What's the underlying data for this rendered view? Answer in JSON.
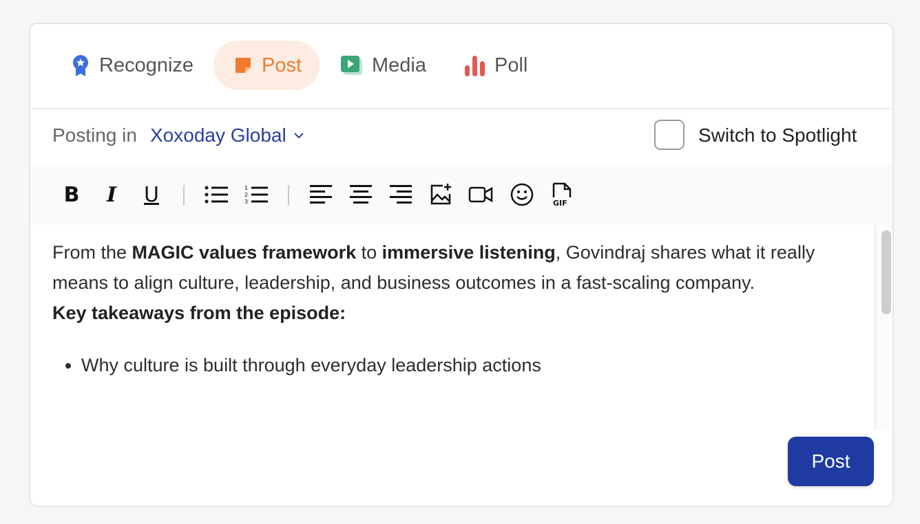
{
  "tabs": [
    {
      "label": "Recognize",
      "icon": "ribbon-badge-icon",
      "color": "#3b6fe0"
    },
    {
      "label": "Post",
      "icon": "sticky-note-icon",
      "color": "#f07b2f",
      "active": true
    },
    {
      "label": "Media",
      "icon": "play-video-icon",
      "color": "#3aa577"
    },
    {
      "label": "Poll",
      "icon": "bar-chart-icon",
      "color": "#e05a4f"
    }
  ],
  "posting": {
    "prefix": "Posting in",
    "group": "Xoxoday Global",
    "spotlight_label": "Switch to Spotlight"
  },
  "toolbar": {
    "bold": "B",
    "italic": "I",
    "underline": "U"
  },
  "editor": {
    "line1_start": "From the ",
    "line1_bold1": "MAGIC values framework",
    "line1_mid": " to ",
    "line1_bold2": "immersive listening",
    "line1_end": ", Govindraj shares what it really means to align culture, leadership, and business outcomes in a fast-scaling company.",
    "heading": "Key takeaways from the episode:",
    "bullets": [
      "Why culture is built through everyday leadership actions"
    ]
  },
  "actions": {
    "post_label": "Post"
  },
  "colors": {
    "accent": "#1f3aa0",
    "post_tab_bg": "#fdece1",
    "link": "#2a3fa0"
  }
}
